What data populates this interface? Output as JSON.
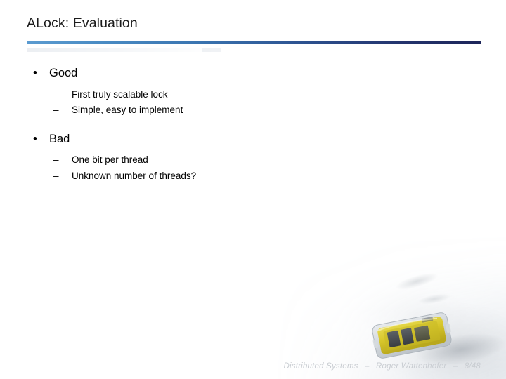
{
  "slide": {
    "title": "ALock: Evaluation",
    "body": {
      "sections": [
        {
          "heading": "Good",
          "points": [
            "First truly scalable lock",
            "Simple, easy to implement"
          ]
        },
        {
          "heading": "Bad",
          "points": [
            "One bit per thread",
            "Unknown number of threads?"
          ]
        }
      ]
    },
    "bullet_glyph": "•",
    "dash_glyph": "–",
    "footer": {
      "course": "Distributed Systems",
      "separator_1": "–",
      "author": "Roger Wattenhofer",
      "separator_2": "–",
      "page": "8/48"
    },
    "colors": {
      "background": "#ffffff",
      "title_text": "#1c1c1c",
      "body_text": "#000000",
      "rule_start": "#5b9bd0",
      "rule_end": "#1c2559",
      "footer_text": "#c9cdd2",
      "node_yellow": "#d8c62a",
      "node_dark": "#4c5054"
    },
    "decoration": {
      "photo_caption": "sensor-node-on-snow-photo"
    }
  }
}
